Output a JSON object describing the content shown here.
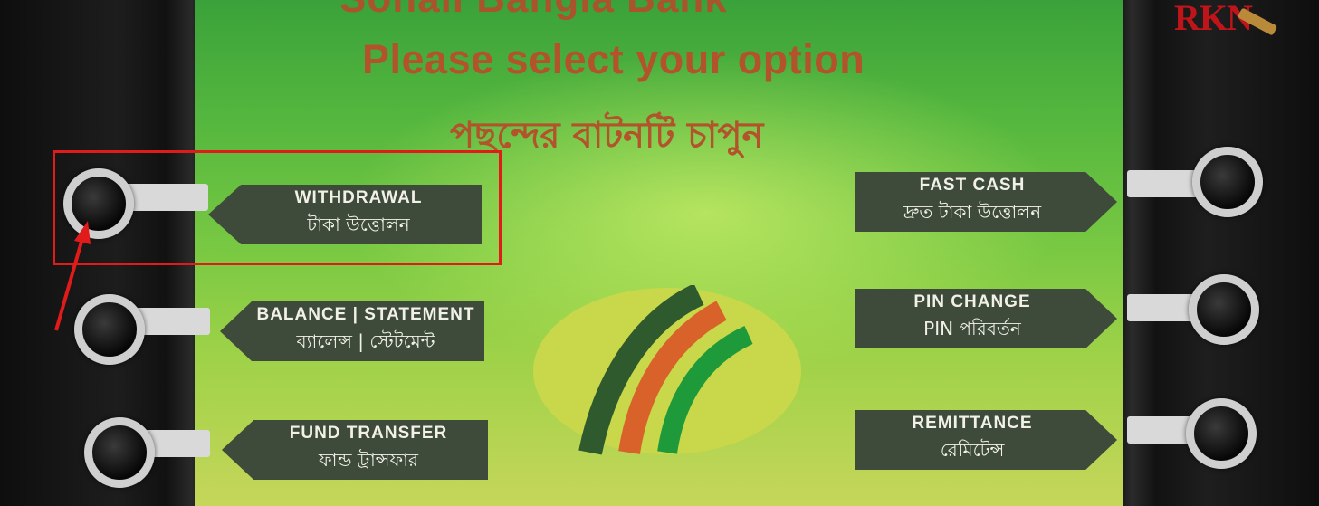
{
  "screen": {
    "bank_title": "Sonali Bangla Bank",
    "headline": "Please select your option",
    "headline_bn": "পছন্দের বাটনটি চাপুন"
  },
  "options": {
    "withdrawal": {
      "en": "Withdrawal",
      "bn": "টাকা উত্তোলন"
    },
    "balance": {
      "en": "Balance | Statement",
      "bn": "ব্যালেন্স | স্টেটমেন্ট"
    },
    "fund_transfer": {
      "en": "Fund Transfer",
      "bn": "ফান্ড ট্রান্সফার"
    },
    "fast_cash": {
      "en": "Fast Cash",
      "bn": "দ্রুত টাকা উত্তোলন"
    },
    "pin_change": {
      "en": "PIN Change",
      "bn": "PIN পরিবর্তন"
    },
    "remittance": {
      "en": "Remittance",
      "bn": "রেমিটেন্স"
    }
  },
  "watermark": "RKN",
  "colors": {
    "headline": "#b3532c",
    "label_bg": "#3e4a3a",
    "highlight": "#e11a1a",
    "logo_green": "#1f9a3a",
    "logo_orange": "#d9622b",
    "logo_dark": "#2e5a2e"
  }
}
